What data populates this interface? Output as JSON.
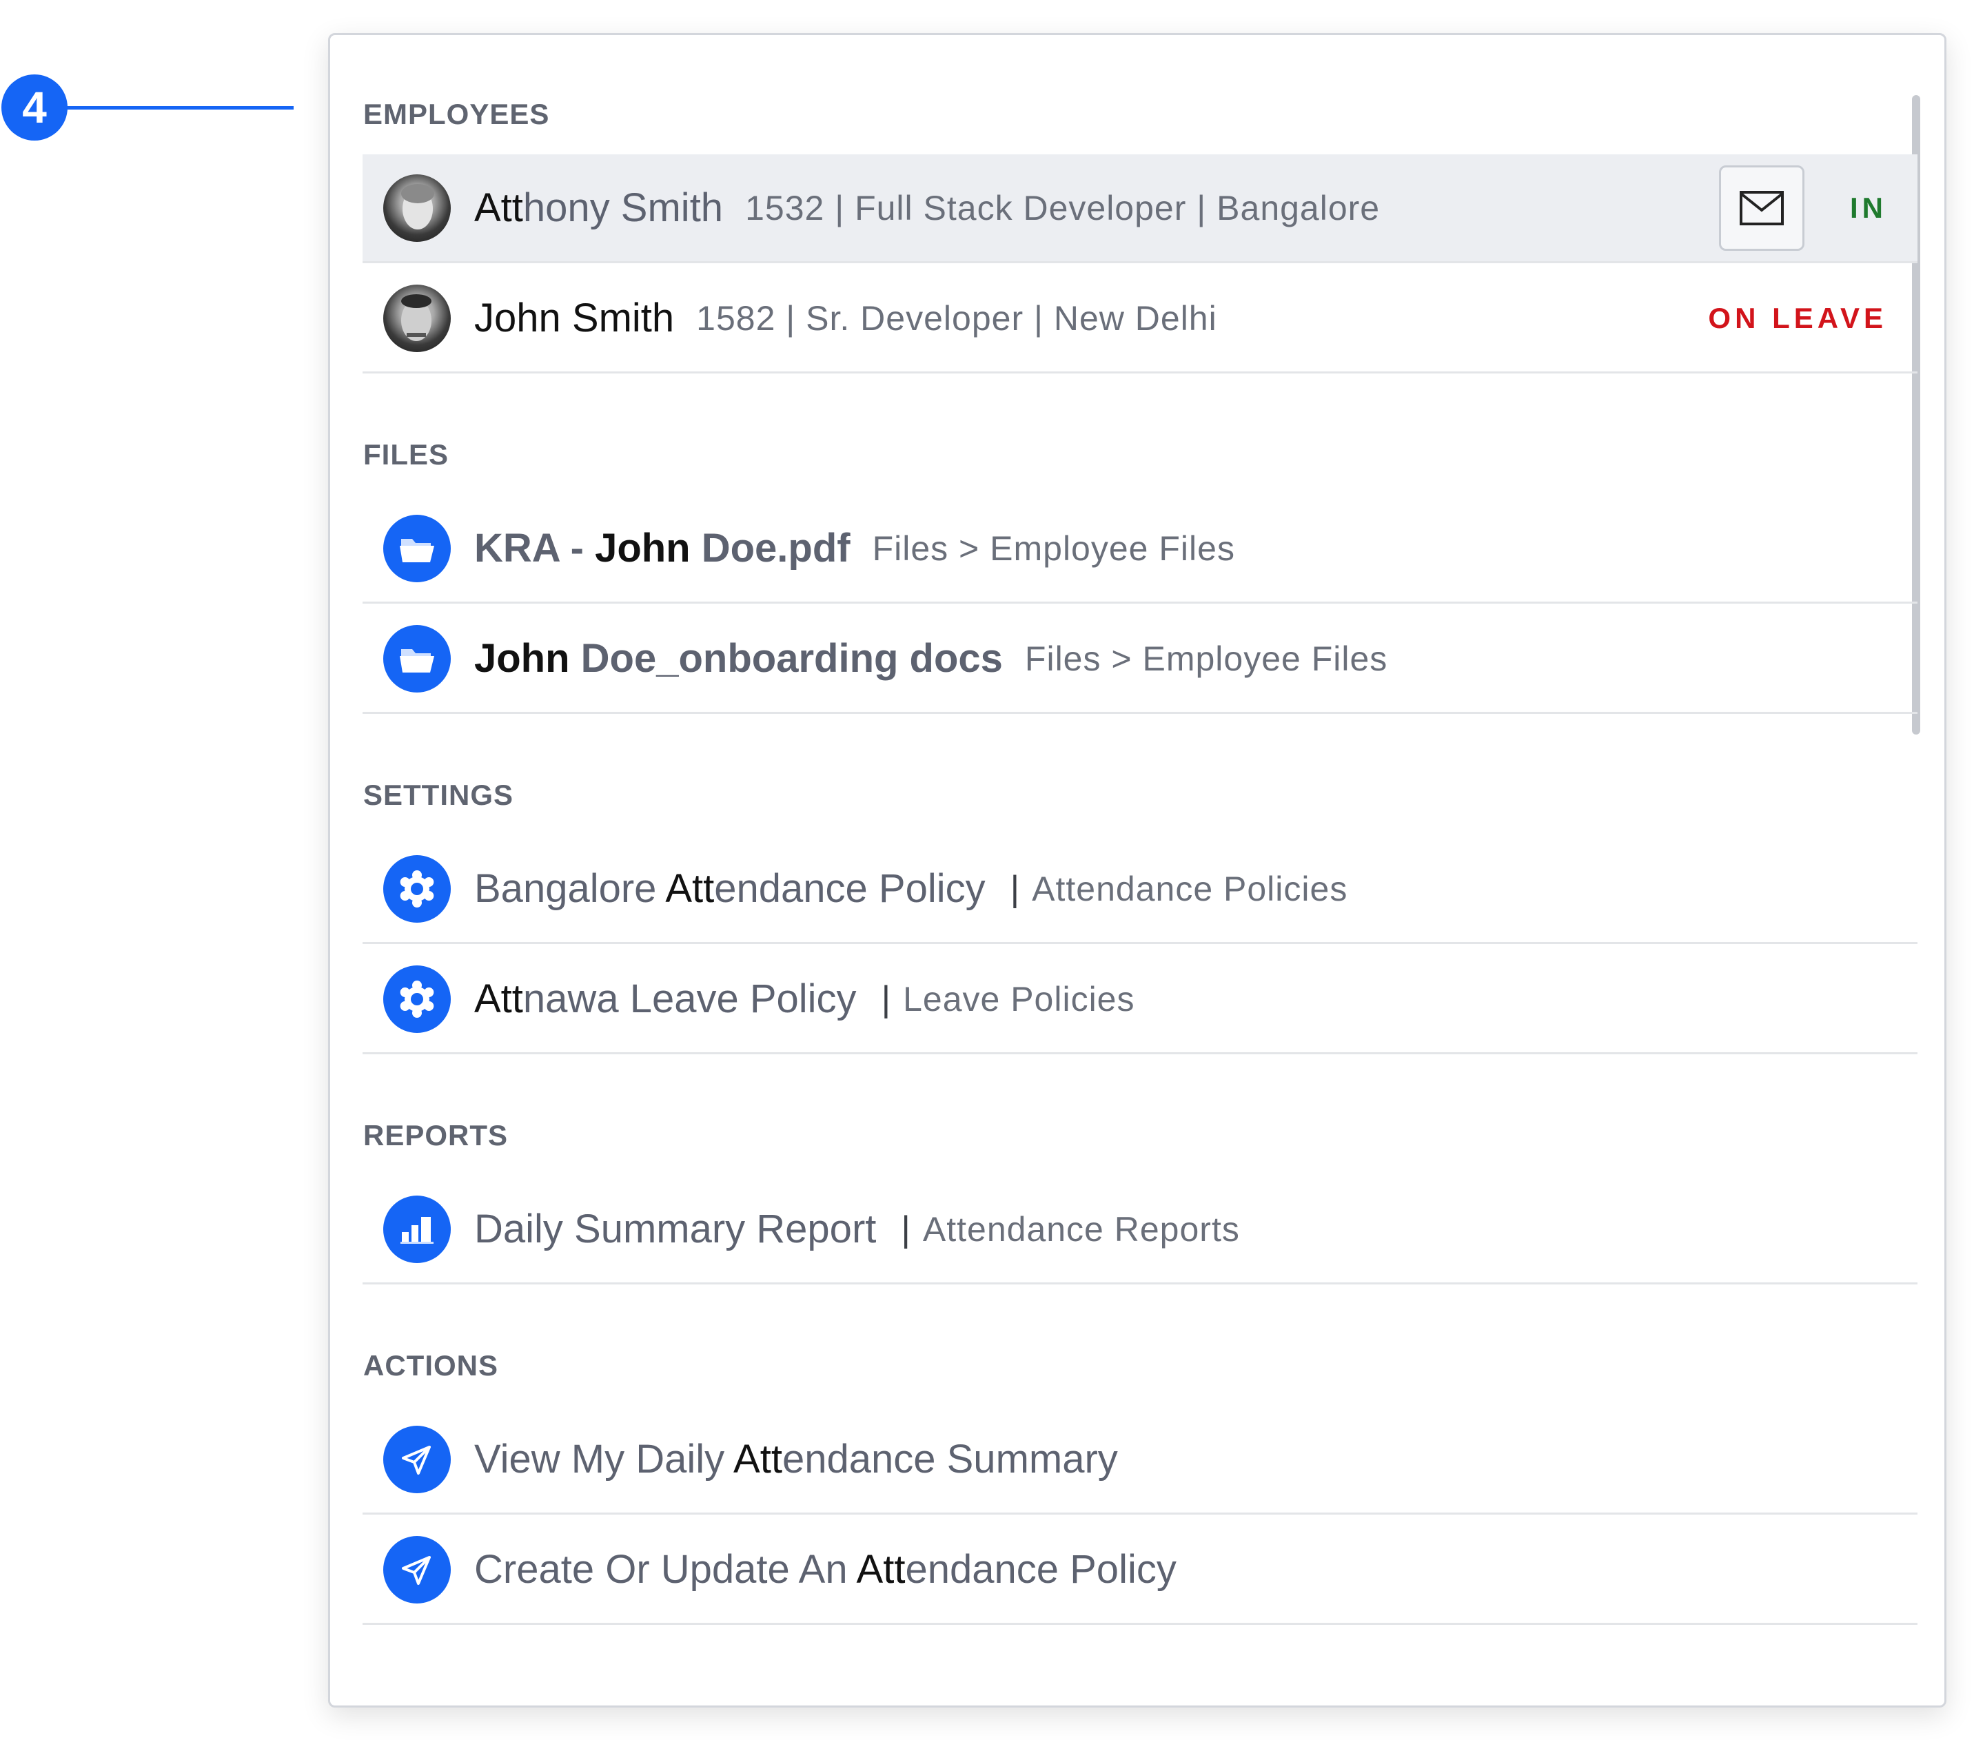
{
  "callout": {
    "number": "4",
    "color": "#1565f5"
  },
  "colors": {
    "accent": "#1565f5",
    "status_in": "#1f7a2e",
    "status_leave": "#d2141b"
  },
  "sections": {
    "employees": {
      "heading": "EMPLOYEES",
      "items": [
        {
          "name_match": "Att",
          "name_rest": "hony Smith",
          "details": "1532 | Full Stack Developer | Bangalore",
          "status": "IN",
          "action_icon": "mail-icon",
          "avatar": "avatar-photo"
        },
        {
          "name": "John Smith",
          "details": "1582 | Sr. Developer | New Delhi",
          "status": "ON LEAVE",
          "avatar": "avatar-photo"
        }
      ]
    },
    "files": {
      "heading": "FILES",
      "items": [
        {
          "pre": "KRA - ",
          "match": "John",
          "post": " Doe.pdf",
          "path": "Files > Employee Files",
          "icon": "folder-icon"
        },
        {
          "match": "John",
          "post": " Doe_onboarding docs",
          "path": "Files > Employee Files",
          "icon": "folder-icon"
        }
      ]
    },
    "settings": {
      "heading": "SETTINGS",
      "items": [
        {
          "pre": "Bangalore ",
          "match": "Att",
          "post": "endance Policy",
          "category": "Attendance Policies",
          "icon": "gear-icon"
        },
        {
          "match": "Att",
          "post": "nawa Leave Policy",
          "category": "Leave Policies",
          "icon": "gear-icon"
        }
      ]
    },
    "reports": {
      "heading": "REPORTS",
      "items": [
        {
          "title": "Daily Summary Report",
          "category": "Attendance Reports",
          "icon": "bar-chart-icon"
        }
      ]
    },
    "actions": {
      "heading": "ACTIONS",
      "items": [
        {
          "pre": "View My Daily ",
          "match": "Att",
          "post": "endance Summary",
          "icon": "send-icon"
        },
        {
          "pre": "Create Or Update An ",
          "match": "Att",
          "post": "endance Policy",
          "icon": "send-icon"
        }
      ]
    }
  }
}
